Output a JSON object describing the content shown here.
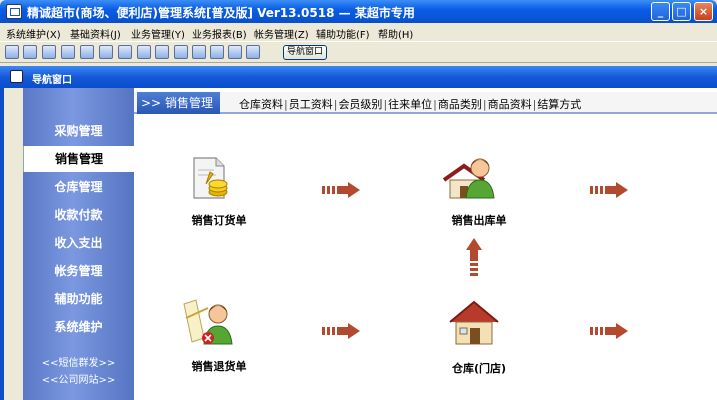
{
  "window": {
    "title": "精诚超市(商场、便利店)管理系统[普及版] Ver13.0518 — 某超市专用",
    "min": "_",
    "max": "□",
    "close": "×"
  },
  "menu": [
    "系统维护(X)",
    "基础资料(J)",
    "业务管理(Y)",
    "业务报表(B)",
    "帐务管理(Z)",
    "辅助功能(F)",
    "帮助(H)"
  ],
  "toolbar": {
    "nav_button": "导航窗口"
  },
  "navwin": {
    "title": "导航窗口"
  },
  "sidebar": {
    "items": [
      "采购管理",
      "销售管理",
      "仓库管理",
      "收款付款",
      "收入支出",
      "帐务管理",
      "辅助功能",
      "系统维护"
    ],
    "active": "销售管理",
    "links": [
      "<<短信群发>>",
      "<<公司网站>>"
    ]
  },
  "tabbar": {
    "active": "销售管理",
    "tabs": [
      "仓库资料",
      "员工资料",
      "会员级别",
      "往来单位",
      "商品类别",
      "商品资料",
      "结算方式"
    ]
  },
  "flow": {
    "nodes": {
      "order": "销售订货单",
      "outbound": "销售出库单",
      "return": "销售退货单",
      "warehouse": "仓库(门店)"
    }
  },
  "colors": {
    "titlebar": "#0a5ee6",
    "sidebar": "#6b88d4",
    "arrow": "#b34a2f",
    "tab_active": "#2857b5"
  }
}
